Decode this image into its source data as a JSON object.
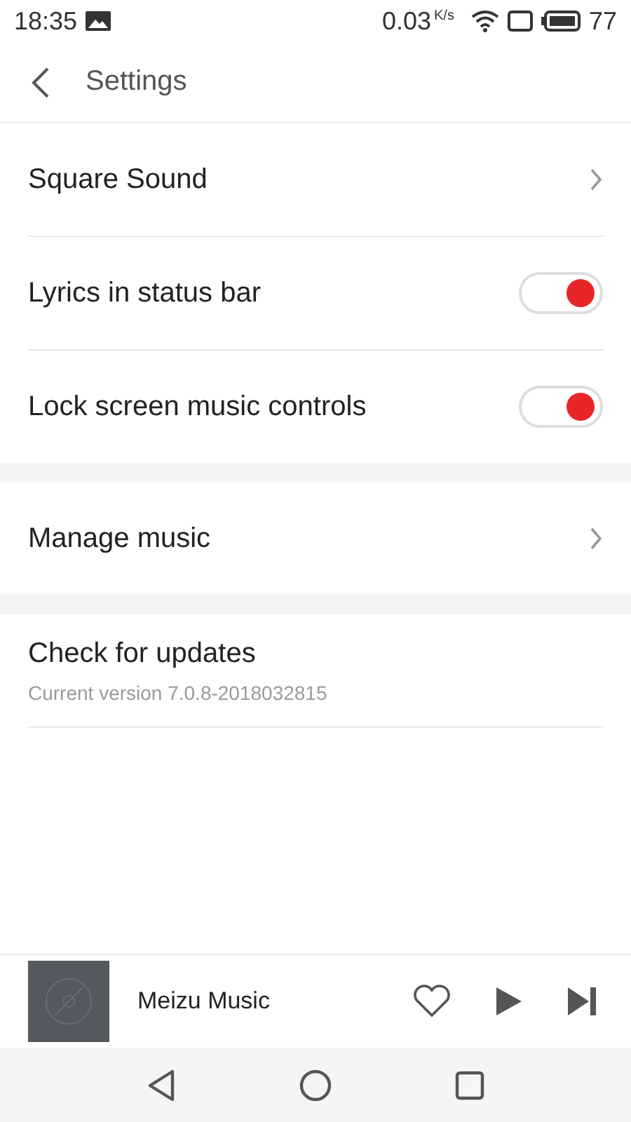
{
  "status_bar": {
    "time": "18:35",
    "speed": "0.03",
    "speed_unit": "K/s",
    "battery": "77"
  },
  "header": {
    "title": "Settings"
  },
  "sections": [
    {
      "items": [
        {
          "kind": "link",
          "label": "Square Sound"
        },
        {
          "kind": "toggle",
          "label": "Lyrics in status bar",
          "on": true
        },
        {
          "kind": "toggle",
          "label": "Lock screen music controls",
          "on": true
        }
      ]
    },
    {
      "items": [
        {
          "kind": "link",
          "label": "Manage music"
        }
      ]
    },
    {
      "items": [
        {
          "kind": "info",
          "label": "Check for updates",
          "subtitle": "Current version 7.0.8-2018032815"
        }
      ]
    }
  ],
  "player": {
    "title": "Meizu Music",
    "liked": false
  }
}
